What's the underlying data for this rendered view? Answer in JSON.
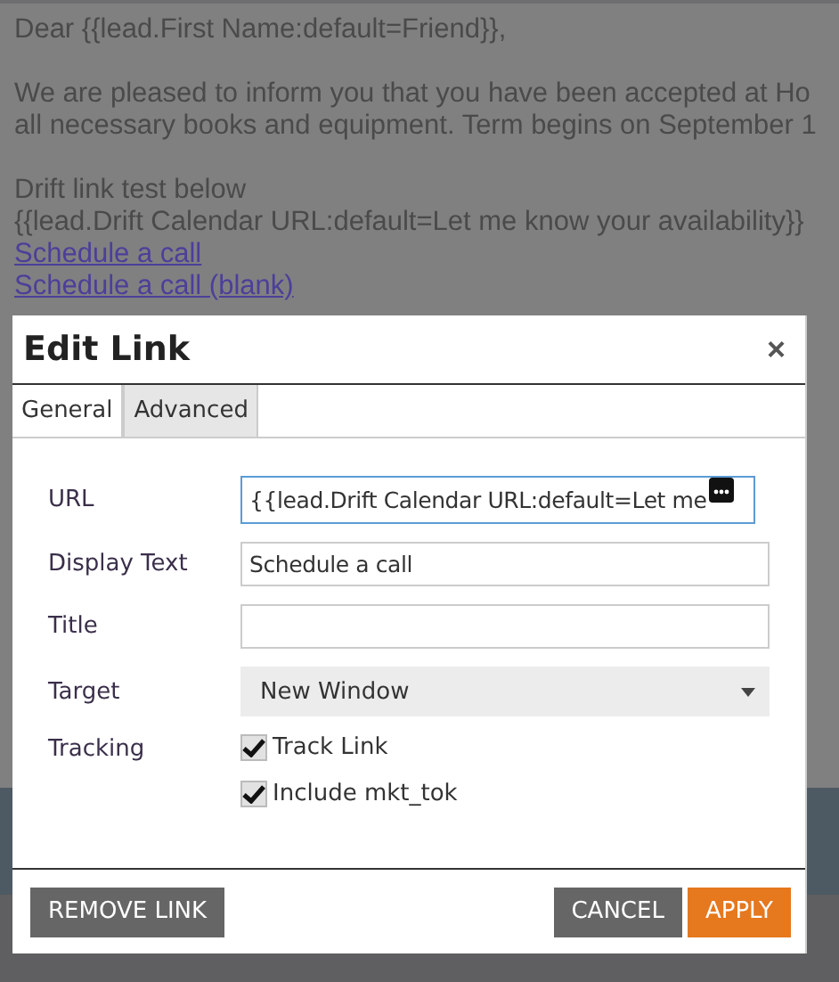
{
  "email": {
    "lines": [
      {
        "kind": "text",
        "text": "Dear {{lead.First Name:default=Friend}},"
      },
      {
        "kind": "gap"
      },
      {
        "kind": "text",
        "text": "We are pleased to inform you that you have been accepted at Ho"
      },
      {
        "kind": "text",
        "text": "all necessary books and equipment. Term begins on September 1"
      },
      {
        "kind": "gap"
      },
      {
        "kind": "text",
        "text": "Drift link test below"
      },
      {
        "kind": "text",
        "text": "{{lead.Drift Calendar URL:default=Let me know your availability}}"
      },
      {
        "kind": "link",
        "text": "Schedule a call"
      },
      {
        "kind": "link",
        "text": "Schedule a call (blank)"
      }
    ]
  },
  "dialog": {
    "title": "Edit Link",
    "close": "×",
    "tabs": [
      {
        "label": "General",
        "selected": true
      },
      {
        "label": "Advanced",
        "selected": false
      }
    ],
    "fields": [
      {
        "kind": "text",
        "label": "URL",
        "value": "{{lead.Drift Calendar URL:default=Let me",
        "focused": true
      },
      {
        "kind": "text",
        "label": "Display Text",
        "value": "Schedule a call",
        "focused": false
      },
      {
        "kind": "text",
        "label": "Title",
        "focused": false
      },
      {
        "kind": "select",
        "label": "Target",
        "value": "New Window"
      },
      {
        "kind": "checkbox",
        "label": "Tracking",
        "options": [
          {
            "label": "Track Link",
            "checked": true
          },
          {
            "label": "Include mkt_tok",
            "checked": true
          }
        ]
      }
    ],
    "left_buttons": [
      {
        "label": "REMOVE LINK",
        "kind": "secondary"
      }
    ],
    "right_buttons": [
      {
        "label": "CANCEL",
        "kind": "secondary"
      },
      {
        "label": "APPLY",
        "kind": "primary"
      }
    ]
  }
}
